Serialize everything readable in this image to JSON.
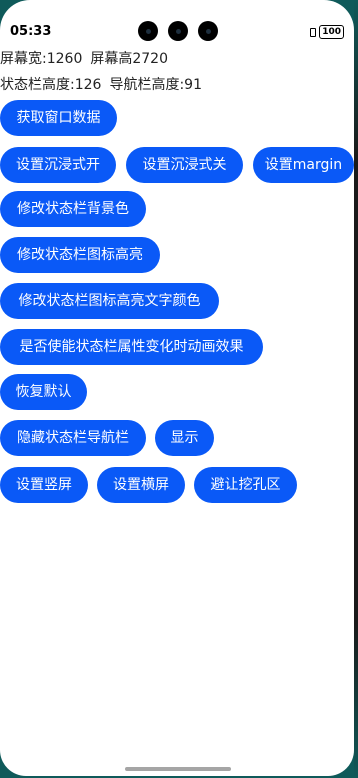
{
  "status_bar": {
    "time": "05:33",
    "battery": "100"
  },
  "info": {
    "screen_width": "屏幕宽:1260",
    "screen_height": "屏幕高2720",
    "status_bar_height": "状态栏高度:126",
    "nav_bar_height": "导航栏高度:91"
  },
  "buttons": {
    "get_window_data": "获取窗口数据",
    "immersive_on": "设置沉浸式开",
    "immersive_off": "设置沉浸式关",
    "set_margin": "设置margin",
    "status_bar_bg": "修改状态栏背景色",
    "status_bar_icon_highlight": "修改状态栏图标高亮",
    "status_bar_icon_text_color": "修改状态栏图标高亮文字颜色",
    "status_bar_animation": "是否使能状态栏属性变化时动画效果",
    "restore_default": "恢复默认",
    "hide_bars": "隐藏状态栏导航栏",
    "show": "显示",
    "portrait": "设置竖屏",
    "landscape": "设置横屏",
    "avoid_cutout": "避让挖孔区"
  }
}
